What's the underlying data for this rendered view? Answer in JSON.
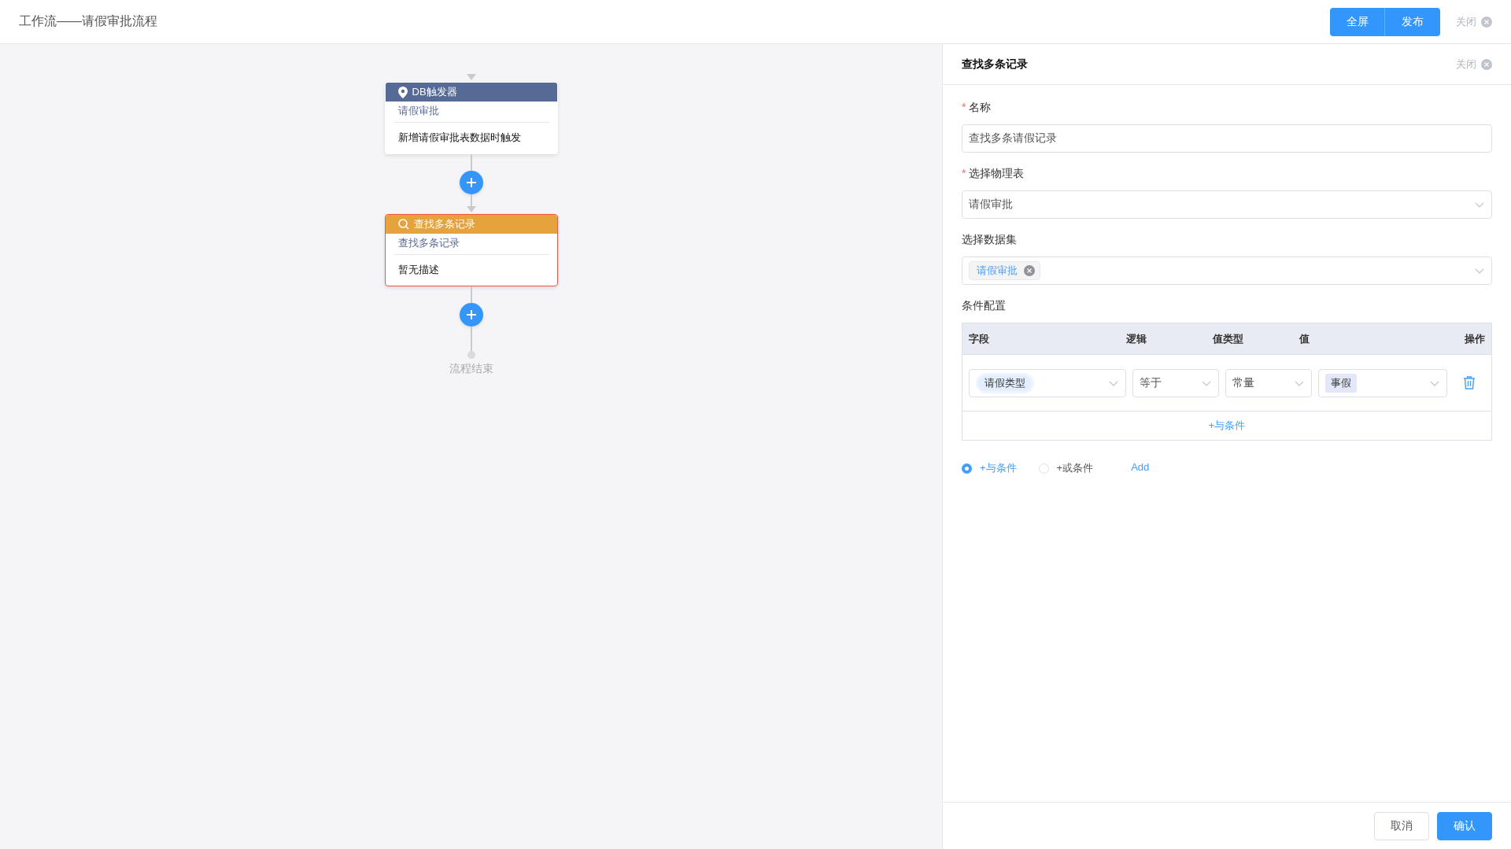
{
  "header": {
    "title": "工作流——请假审批流程",
    "buttons": [
      {
        "label": "全屏"
      },
      {
        "label": "发布"
      }
    ],
    "close": "关闭"
  },
  "flow": {
    "nodes": [
      {
        "kind": "trigger",
        "title": "DB触发器",
        "subtitle": "请假审批",
        "description": "新增请假审批表数据时触发",
        "selected": false
      },
      {
        "kind": "query",
        "title": "查找多条记录",
        "subtitle": "查找多条记录",
        "description": "暂无描述",
        "selected": true
      }
    ],
    "end_label": "流程结束"
  },
  "panel": {
    "title": "查找多条记录",
    "close": "关闭",
    "fields": [
      {
        "kind": "input",
        "required_mark": "*",
        "label": "名称",
        "value": "查找多条请假记录"
      },
      {
        "kind": "select",
        "required_mark": "*",
        "label": "选择物理表",
        "value": "请假审批"
      },
      {
        "kind": "tags",
        "label": "选择数据集",
        "tags": [
          "请假审批"
        ]
      }
    ],
    "conditions": {
      "label": "条件配置",
      "columns": [
        "字段",
        "逻辑",
        "值类型",
        "值",
        "操作"
      ],
      "rows": [
        {
          "field": "请假类型",
          "logic": "等于",
          "value_type": "常量",
          "value": "事假"
        }
      ],
      "add_link": "+与条件"
    },
    "radios": [
      {
        "label": "+与条件",
        "selected": true
      },
      {
        "label": "+或条件",
        "selected": false
      }
    ],
    "add_link": "Add",
    "footer": [
      {
        "label": "取消",
        "kind": "default"
      },
      {
        "label": "确认",
        "kind": "primary"
      }
    ]
  }
}
